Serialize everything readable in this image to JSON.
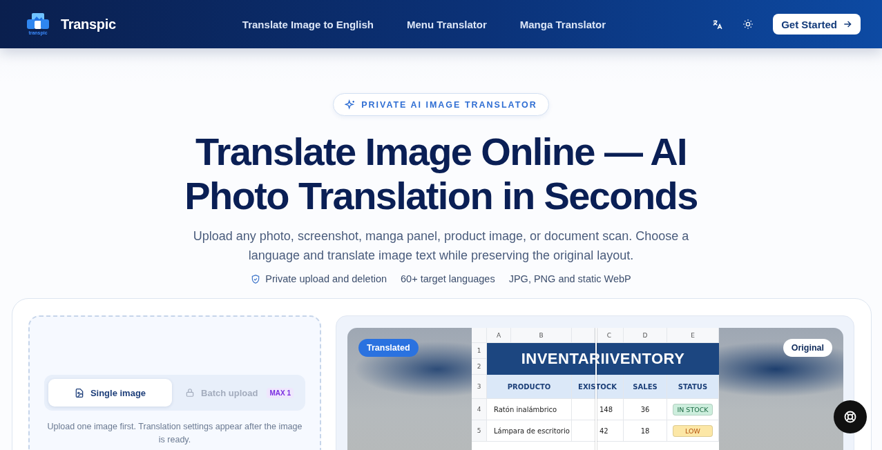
{
  "header": {
    "logo_caption": "transpic",
    "brand": "Transpic",
    "nav": [
      "Translate Image to English",
      "Menu Translator",
      "Manga Translator"
    ],
    "cta": "Get Started"
  },
  "hero": {
    "badge": "PRIVATE AI IMAGE TRANSLATOR",
    "title_lines": [
      "Translate Image Online — AI",
      "Photo Translation in Seconds"
    ],
    "subtitle": "Upload any photo, screenshot, manga panel, product image, or document scan. Choose a language and translate image text while preserving the original layout.",
    "features": [
      {
        "label": "Private upload and deletion",
        "kind": "shield"
      },
      {
        "label": "60+ target languages",
        "kind": "plain"
      },
      {
        "label": "JPG, PNG and static WebP",
        "kind": "plain"
      }
    ]
  },
  "upload": {
    "modes": [
      {
        "label": "Single image",
        "selected": true,
        "disabled": false
      },
      {
        "label": "Batch upload",
        "selected": false,
        "disabled": true,
        "badge": "MAX 1"
      }
    ],
    "hint": "Upload one image first. Translation settings appear after the image is ready."
  },
  "preview": {
    "translated_label": "Translated",
    "original_label": "Original",
    "sheet": {
      "col_letters": [
        "A",
        "B",
        "C",
        "D",
        "E"
      ],
      "title": "INVENTARIIVENTORY",
      "headers": [
        "PRODUCTO",
        "EXISTOCK",
        "SALES",
        "STATUS"
      ],
      "rows": [
        {
          "number": "4",
          "product": "Ratón inalámbrico",
          "stock": "148",
          "sales": "36",
          "status": {
            "label": "IN STOCK",
            "color": "#cdeedd"
          }
        },
        {
          "number": "5",
          "product": "Lámpara de escritorio",
          "stock": "42",
          "sales": "18",
          "status": {
            "label": "LOW",
            "color": "#fce7a6"
          }
        }
      ],
      "title_rows": [
        "1",
        "2"
      ],
      "header_row": "3"
    }
  }
}
